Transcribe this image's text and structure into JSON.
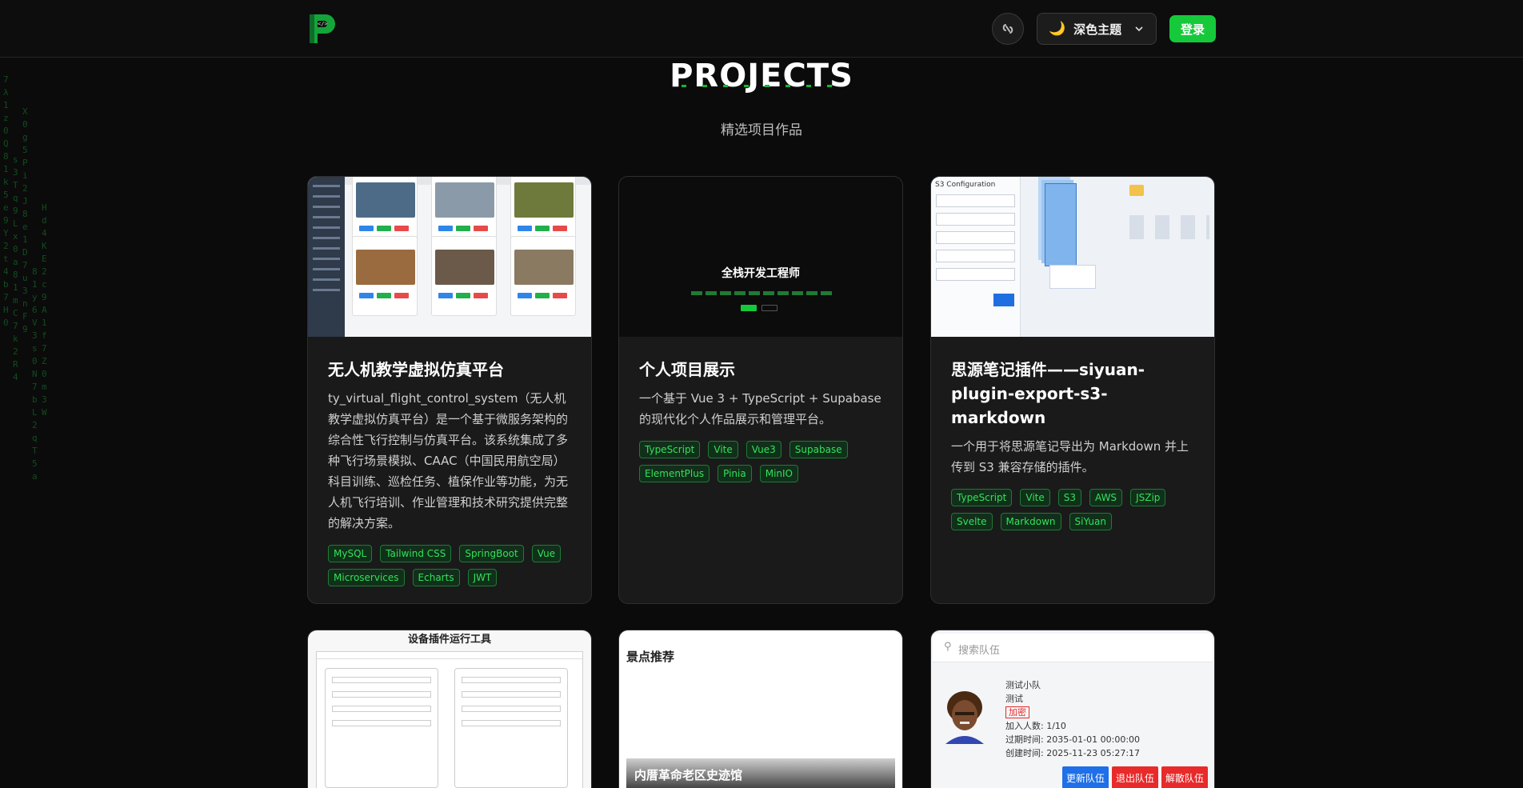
{
  "header": {
    "theme_label": "深色主题",
    "theme_icon": "moon-icon",
    "login_label": "登录",
    "link_icon": "link-icon"
  },
  "section": {
    "title": "PROJECTS",
    "subtitle": "精选项目作品"
  },
  "projects": [
    {
      "title": "无人机教学虚拟仿真平台",
      "description": "ty_virtual_flight_control_system（无人机教学虚拟仿真平台）是一个基于微服务架构的综合性飞行控制与仿真平台。该系统集成了多种飞行场景模拟、CAAC（中国民用航空局）科目训练、巡检任务、植保作业等功能，为无人机飞行培训、作业管理和技术研究提供完整的解决方案。",
      "tags": [
        "MySQL",
        "Tailwind CSS",
        "SpringBoot",
        "Vue",
        "Microservices",
        "Echarts",
        "JWT"
      ]
    },
    {
      "title": "个人项目展示",
      "description": "一个基于 Vue 3 + TypeScript + Supabase 的现代化个人作品展示和管理平台。",
      "tags": [
        "TypeScript",
        "Vite",
        "Vue3",
        "Supabase",
        "ElementPlus",
        "Pinia",
        "MinIO"
      ],
      "thumb_title": "全栈开发工程师"
    },
    {
      "title": "思源笔记插件——siyuan-plugin-export-s3-markdown",
      "description": "一个用于将思源笔记导出为 Markdown 并上传到 S3 兼容存储的插件。",
      "tags": [
        "TypeScript",
        "Vite",
        "S3",
        "AWS",
        "JSZip",
        "Svelte",
        "Markdown",
        "SiYuan"
      ],
      "thumb_heading": "S3 Configuration"
    }
  ],
  "second_row": {
    "card4_title": "设备插件运行工具",
    "card5_label": "景点推荐",
    "card5_caption": "内厝革命老区史迹馆",
    "card6": {
      "search_placeholder": "搜索队伍",
      "team_name": "测试小队",
      "team_desc": "测试",
      "badge": "加密",
      "members": "加入人数: 1/10",
      "expire": "过期时间: 2035-01-01 00:00:00",
      "created": "创建时间: 2025-11-23 05:27:17",
      "btn_update": "更新队伍",
      "btn_quit": "退出队伍",
      "btn_dissolve": "解散队伍"
    }
  },
  "colors": {
    "accent": "#16c93a",
    "tag_text": "#35e05a",
    "background": "#0b0b0b",
    "card": "#1a1a1a"
  }
}
